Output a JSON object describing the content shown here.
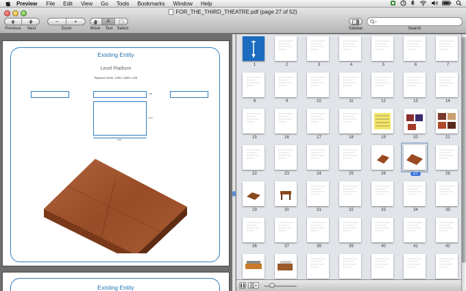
{
  "menubar": {
    "app_name": "Preview",
    "items": [
      "File",
      "Edit",
      "View",
      "Go",
      "Tools",
      "Bookmarks",
      "Window",
      "Help"
    ]
  },
  "window": {
    "title": "FOR_THE_THIRD_THEATRE.pdf (page 27 of 52)"
  },
  "toolbar": {
    "previous_label": "Previous",
    "next_label": "Next",
    "zoom_label": "Zoom",
    "move_label": "Move",
    "text_label": "Text",
    "select_label": "Select",
    "sidebar_label": "Sidebar",
    "search_label": "Search",
    "zoom_out_glyph": "−",
    "zoom_in_glyph": "+",
    "text_tool_glyph": "A"
  },
  "document": {
    "page_title": "Existing Entity",
    "page_subtitle": "Level Platform",
    "page_description": "Plywood 17mm. 1200 x 1800 x 228",
    "dim_width": "1800",
    "dim_height": "1200",
    "dim_depth": "228",
    "next_page_title": "Existing Entity"
  },
  "thumbnails": {
    "labels": [
      "1",
      "2",
      "3",
      "4",
      "5",
      "6",
      "7",
      "8",
      "9",
      "10",
      "11",
      "12",
      "13",
      "14",
      "15",
      "16",
      "17",
      "18",
      "19",
      "20",
      "21",
      "22",
      "23",
      "24",
      "25",
      "26",
      "27",
      "28",
      "29",
      "30",
      "31",
      "32",
      "33",
      "34",
      "35",
      "36",
      "37",
      "38",
      "39",
      "40",
      "41",
      "42",
      "43",
      "44",
      "45",
      "46",
      "47",
      "48",
      "49"
    ],
    "selected_page": 27,
    "accent": "#3875d7"
  },
  "colors": {
    "platform": "#9a4a22",
    "blueprint": "#2a7bbf"
  }
}
